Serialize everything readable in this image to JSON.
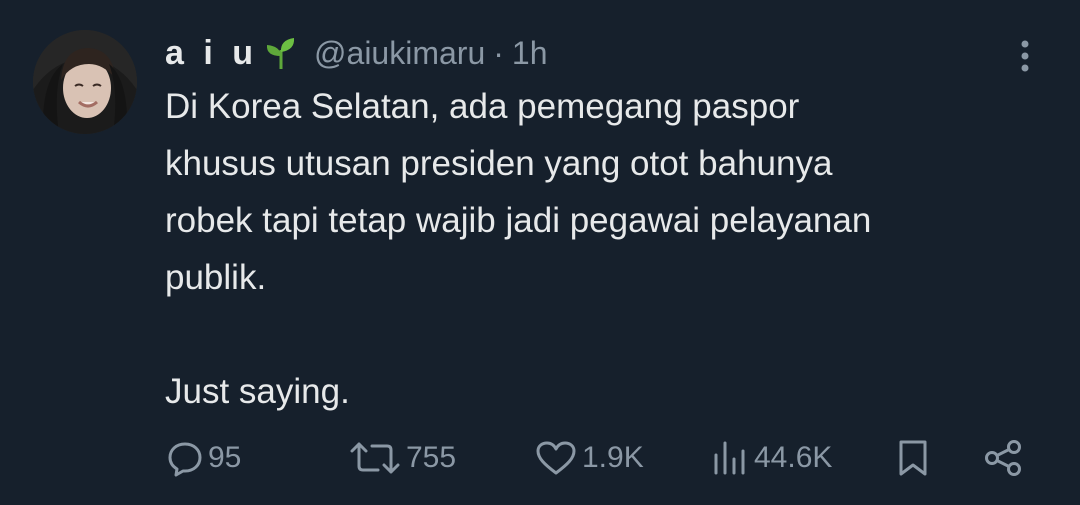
{
  "tweet": {
    "display_name": "a i u",
    "handle": "@aiukimaru",
    "separator": "·",
    "time": "1h",
    "text": "Di Korea Selatan, ada pemegang paspor\nkhusus utusan presiden yang otot bahunya\nrobek tapi tetap wajib jadi pegawai pelayanan\npublik.\n\nJust saying."
  },
  "actions": {
    "replies": "95",
    "reposts": "755",
    "likes": "1.9K",
    "views": "44.6K"
  },
  "icons": {
    "name_emoji": "sprout-icon",
    "more": "more-vertical-icon",
    "reply": "reply-icon",
    "repost": "repost-icon",
    "like": "heart-icon",
    "views": "views-icon",
    "bookmark": "bookmark-icon",
    "share": "share-icon"
  },
  "colors": {
    "background": "#16202c",
    "text": "#e7e9ea",
    "muted": "#8b98a5",
    "sprout": "#5ea83a"
  }
}
